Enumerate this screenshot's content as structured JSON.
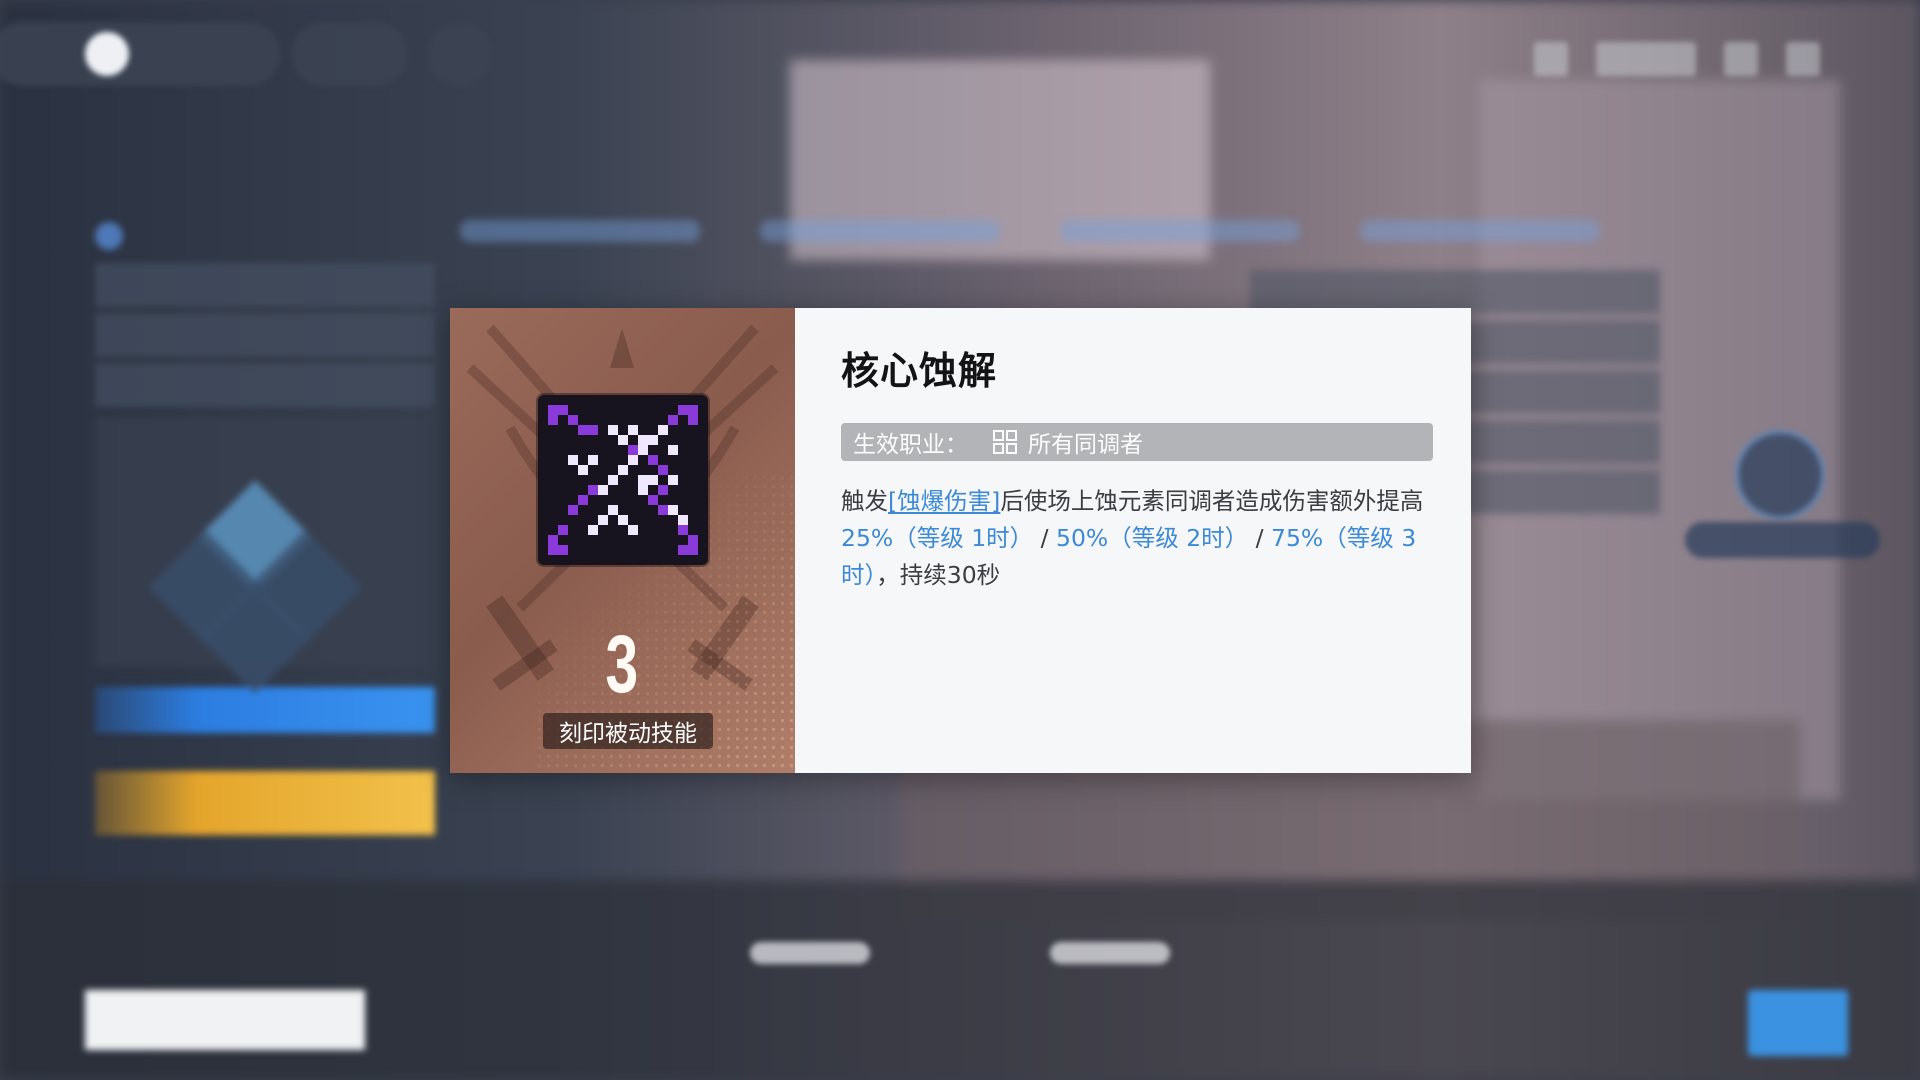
{
  "dialog": {
    "skill_name": "核心蚀解",
    "level_number": "3",
    "skill_type": "刻印被动技能",
    "class_label": "生效职业：",
    "class_value": "所有同调者",
    "description": {
      "prefix": "触发",
      "keyword": "[蚀爆伤害]",
      "middle": "后使场上蚀元素同调者造成伤害额外提高",
      "value1": "25%（等级 1时）",
      "sep1": " / ",
      "value2": "50%（等级 2时）",
      "sep2": " / ",
      "value3": "75%（等级 3时）",
      "suffix": "，持续30秒"
    },
    "icons": {
      "skill": "pixel-bow-icon",
      "class": "grid-squares-icon",
      "emblem": "crossed-swords-emblem-icon"
    }
  },
  "colors": {
    "accent_blue": "#3c8ad6",
    "card_bg": "#9a6a5a",
    "skill_purple": "#8a3ad8"
  }
}
